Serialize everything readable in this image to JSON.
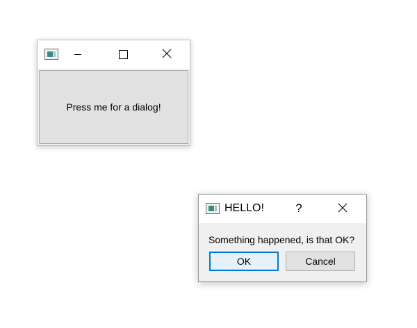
{
  "main_window": {
    "title": "",
    "icon": "app-window-icon",
    "caption_buttons": {
      "minimize": "minimize-icon",
      "maximize": "maximize-icon",
      "close": "close-icon"
    },
    "button_label": "Press me for a dialog!"
  },
  "dialog": {
    "title": "HELLO!",
    "icon": "app-window-icon",
    "help_label": "?",
    "close": "close-icon",
    "message": "Something happened, is that OK?",
    "ok_label": "OK",
    "cancel_label": "Cancel",
    "default_button_color": "#0078d7"
  }
}
